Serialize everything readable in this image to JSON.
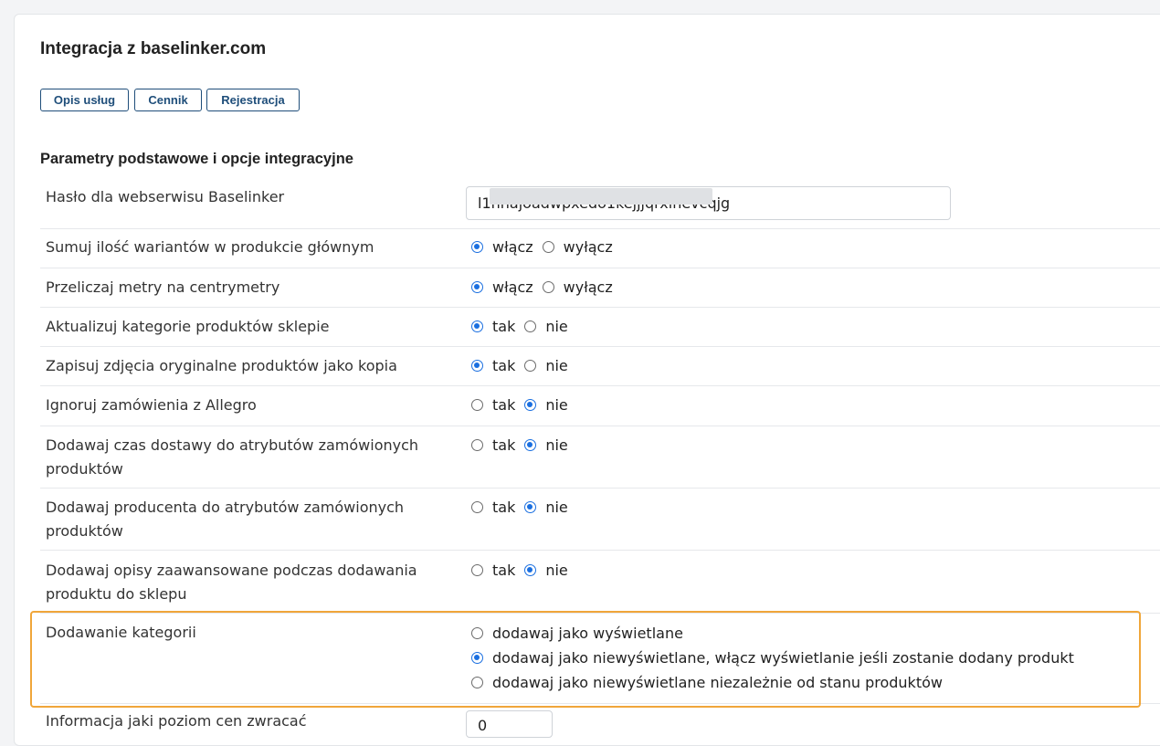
{
  "page": {
    "title": "Integracja z baselinker.com",
    "buttons": [
      "Opis usług",
      "Cennik",
      "Rejestracja"
    ],
    "section_title": "Parametry podstawowe i opcje integracyjne"
  },
  "fields": {
    "password": {
      "label": "Hasło dla webserwisu Baselinker",
      "value": "l1nnajoadwpxedo1kejjjqrxlnevcqjg"
    },
    "rows": [
      {
        "label": "Sumuj ilość wariantów w produkcie głównym",
        "opt1": "włącz",
        "opt2": "wyłącz",
        "selected": 1
      },
      {
        "label": "Przeliczaj metry na centrymetry",
        "opt1": "włącz",
        "opt2": "wyłącz",
        "selected": 1
      },
      {
        "label": "Aktualizuj kategorie produktów sklepie",
        "opt1": "tak",
        "opt2": "nie",
        "selected": 1
      },
      {
        "label": "Zapisuj zdjęcia oryginalne produktów jako kopia",
        "opt1": "tak",
        "opt2": "nie",
        "selected": 1
      },
      {
        "label": "Ignoruj zamówienia z Allegro",
        "opt1": "tak",
        "opt2": "nie",
        "selected": 2
      },
      {
        "label": "Dodawaj czas dostawy do atrybutów zamówionych produktów",
        "opt1": "tak",
        "opt2": "nie",
        "selected": 2
      },
      {
        "label": "Dodawaj producenta do atrybutów zamówionych produktów",
        "opt1": "tak",
        "opt2": "nie",
        "selected": 2
      },
      {
        "label": "Dodawaj opisy zaawansowane podczas dodawania produktu do sklepu",
        "opt1": "tak",
        "opt2": "nie",
        "selected": 2
      }
    ],
    "categories": {
      "label": "Dodawanie kategorii",
      "options": [
        "dodawaj jako wyświetlane",
        "dodawaj jako niewyświetlane, włącz wyświetlanie jeśli zostanie dodany produkt",
        "dodawaj jako niewyświetlane niezależnie od stanu produktów"
      ],
      "selected": 2
    },
    "price_level": {
      "label": "Informacja jaki poziom cen zwracać",
      "value": "0"
    }
  },
  "colors": {
    "accent": "#1a6fe0",
    "button_border": "#1f4e7a",
    "highlight": "#f0a63a"
  }
}
